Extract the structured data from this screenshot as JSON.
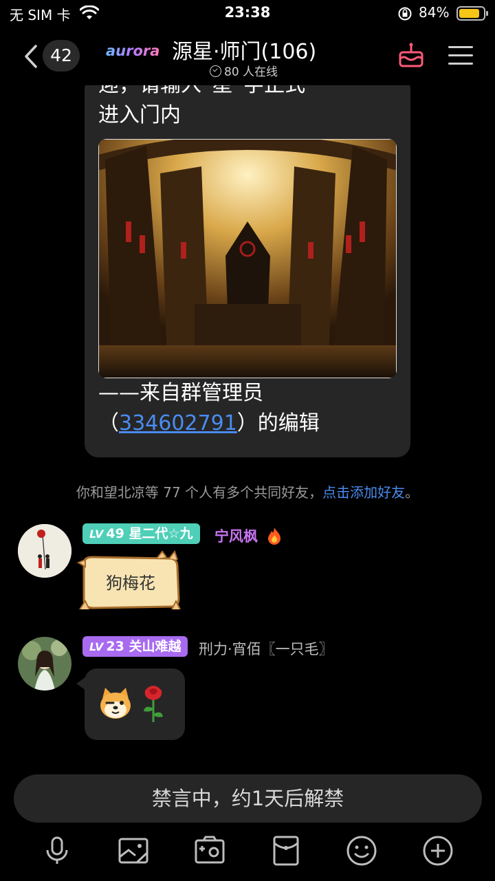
{
  "status_bar": {
    "carrier": "无 SIM 卡",
    "time": "23:38",
    "battery_pct": "84%",
    "battery_level": 0.84
  },
  "nav": {
    "unread_count": "42",
    "logo_text": "aurora",
    "title": "源星·师门(106)",
    "online": "80 人在线"
  },
  "message_card": {
    "line1": "迎，请输入“星”字正式",
    "line2": "进入门内",
    "from_prefix": "——来自群管理员",
    "qq_open": "（",
    "qq_number": "334602791",
    "qq_close": "）的编辑"
  },
  "system_tip": {
    "text": "你和望北凉等 77 个人有多个共同好友，",
    "link": "点击添加好友",
    "end": "。"
  },
  "messages": [
    {
      "level": "49",
      "lv_prefix": "LV",
      "title": "星二代☆九",
      "name": "宁风枫",
      "tag_color": "#4fcfb8",
      "name_color": "#c774f0",
      "sticker_text": "狗梅花"
    },
    {
      "level": "23",
      "lv_prefix": "LV",
      "title": "关山难越",
      "name": "刑力·宵佰〖一只毛〗",
      "tag_color": "#a86bf0",
      "name_color": "#bdbdbd"
    }
  ],
  "mute_bar": {
    "text": "禁言中，约1天后解禁"
  },
  "toolbar": {
    "icons": [
      "microphone-icon",
      "image-icon",
      "camera-icon",
      "red-packet-icon",
      "emoji-icon",
      "plus-icon"
    ]
  }
}
